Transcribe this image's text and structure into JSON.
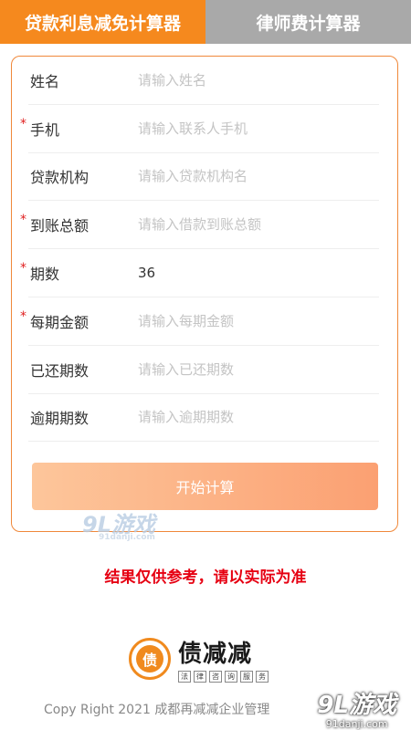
{
  "tabs": [
    {
      "label": "贷款利息减免计算器",
      "active": true
    },
    {
      "label": "律师费计算器",
      "active": false
    }
  ],
  "form": {
    "fields": [
      {
        "label": "姓名",
        "required": false,
        "placeholder": "请输入姓名",
        "value": ""
      },
      {
        "label": "手机",
        "required": true,
        "placeholder": "请输入联系人手机",
        "value": ""
      },
      {
        "label": "贷款机构",
        "required": false,
        "placeholder": "请输入贷款机构名",
        "value": ""
      },
      {
        "label": "到账总额",
        "required": true,
        "placeholder": "请输入借款到账总额",
        "value": ""
      },
      {
        "label": "期数",
        "required": true,
        "placeholder": "",
        "value": "36"
      },
      {
        "label": "每期金额",
        "required": true,
        "placeholder": "请输入每期金额",
        "value": ""
      },
      {
        "label": "已还期数",
        "required": false,
        "placeholder": "请输入已还期数",
        "value": ""
      },
      {
        "label": "逾期期数",
        "required": false,
        "placeholder": "请输入逾期期数",
        "value": ""
      }
    ],
    "required_mark": "*",
    "submit_label": "开始计算"
  },
  "notice": "结果仅供参考，请以实际为准",
  "logo": {
    "badge_char": "债",
    "name": "债减减",
    "tagline": [
      "法",
      "律",
      "咨",
      "询",
      "服",
      "务"
    ]
  },
  "copyright": "Copy Right 2021 成都再减减企业管理",
  "watermarks": {
    "mid": {
      "text": "9L游戏",
      "url": "91danji.com"
    },
    "corner": {
      "text": "9L游戏",
      "url": "91danji.com"
    }
  },
  "colors": {
    "accent": "#f5891e",
    "tab_inactive": "#a9a9a9",
    "required": "#e02020",
    "notice": "#e60012"
  }
}
